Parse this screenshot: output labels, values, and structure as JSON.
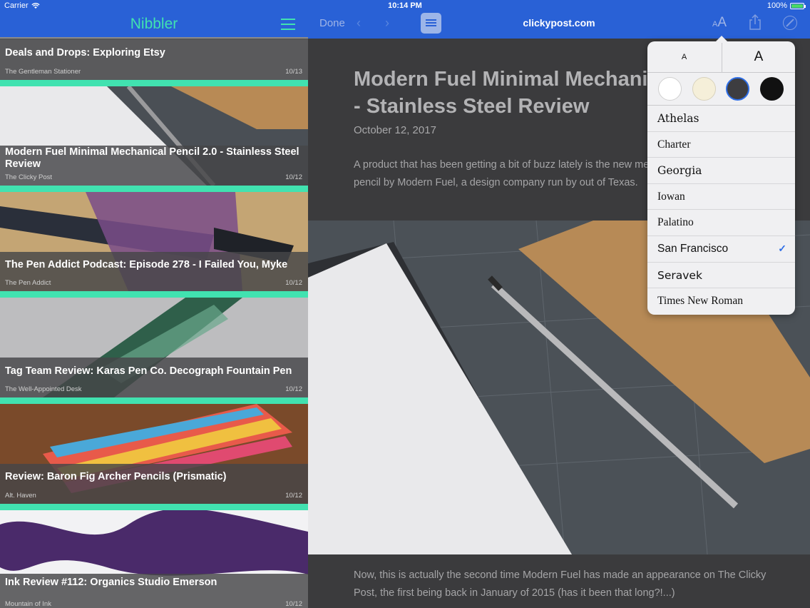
{
  "status_bar": {
    "carrier": "Carrier",
    "time": "10:14 PM",
    "battery": "100%"
  },
  "sidebar": {
    "title": "Nibbler",
    "articles": [
      {
        "title": "Deals and Drops: Exploring Etsy",
        "source": "The Gentleman Stationer",
        "date": "10/13"
      },
      {
        "title": "Modern Fuel Minimal Mechanical Pencil 2.0 - Stainless Steel Review",
        "source": "The Clicky Post",
        "date": "10/12"
      },
      {
        "title": "The Pen Addict Podcast: Episode 278 - I Failed You, Myke",
        "source": "The Pen Addict",
        "date": "10/12"
      },
      {
        "title": "Tag Team Review: Karas Pen Co. Decograph Fountain Pen",
        "source": "The  Well-Appointed Desk",
        "date": "10/12"
      },
      {
        "title": "Review: Baron Fig Archer Pencils (Prismatic)",
        "source": "Alt. Haven",
        "date": "10/12"
      },
      {
        "title": "Ink Review #112: Organics Studio Emerson",
        "source": "Mountain of Ink",
        "date": "10/12"
      }
    ]
  },
  "toolbar": {
    "done_label": "Done",
    "url": "clickypost.com",
    "aa_small": "A",
    "aa_big": "A"
  },
  "reader": {
    "title": "Modern Fuel Minimal Mechanical Pencil 2.0 - Stainless Steel Review",
    "date": "October 12, 2017",
    "intro": "A product that has been getting a bit of buzz lately is the new mechanical pencil by Modern Fuel, a design company run by out of Texas.",
    "body": "Now, this is actually the second time Modern Fuel has made an appearance on The Clicky Post, the first being back in January of 2015 (has it been that long?!...)"
  },
  "popover": {
    "size_small": "A",
    "size_big": "A",
    "themes": [
      {
        "name": "white",
        "color": "#ffffff"
      },
      {
        "name": "sepia",
        "color": "#f5efd9"
      },
      {
        "name": "gray",
        "color": "#3d3d40"
      },
      {
        "name": "black",
        "color": "#111111"
      }
    ],
    "selected_theme": "gray",
    "fonts": [
      "Athelas",
      "Charter",
      "Georgia",
      "Iowan",
      "Palatino",
      "San Francisco",
      "Seravek",
      "Times New Roman"
    ],
    "selected_font": "San Francisco",
    "check_mark": "✓"
  },
  "colors": {
    "accent": "#2961d6",
    "teal": "#41e2b0",
    "check": "#2e6ee6"
  }
}
